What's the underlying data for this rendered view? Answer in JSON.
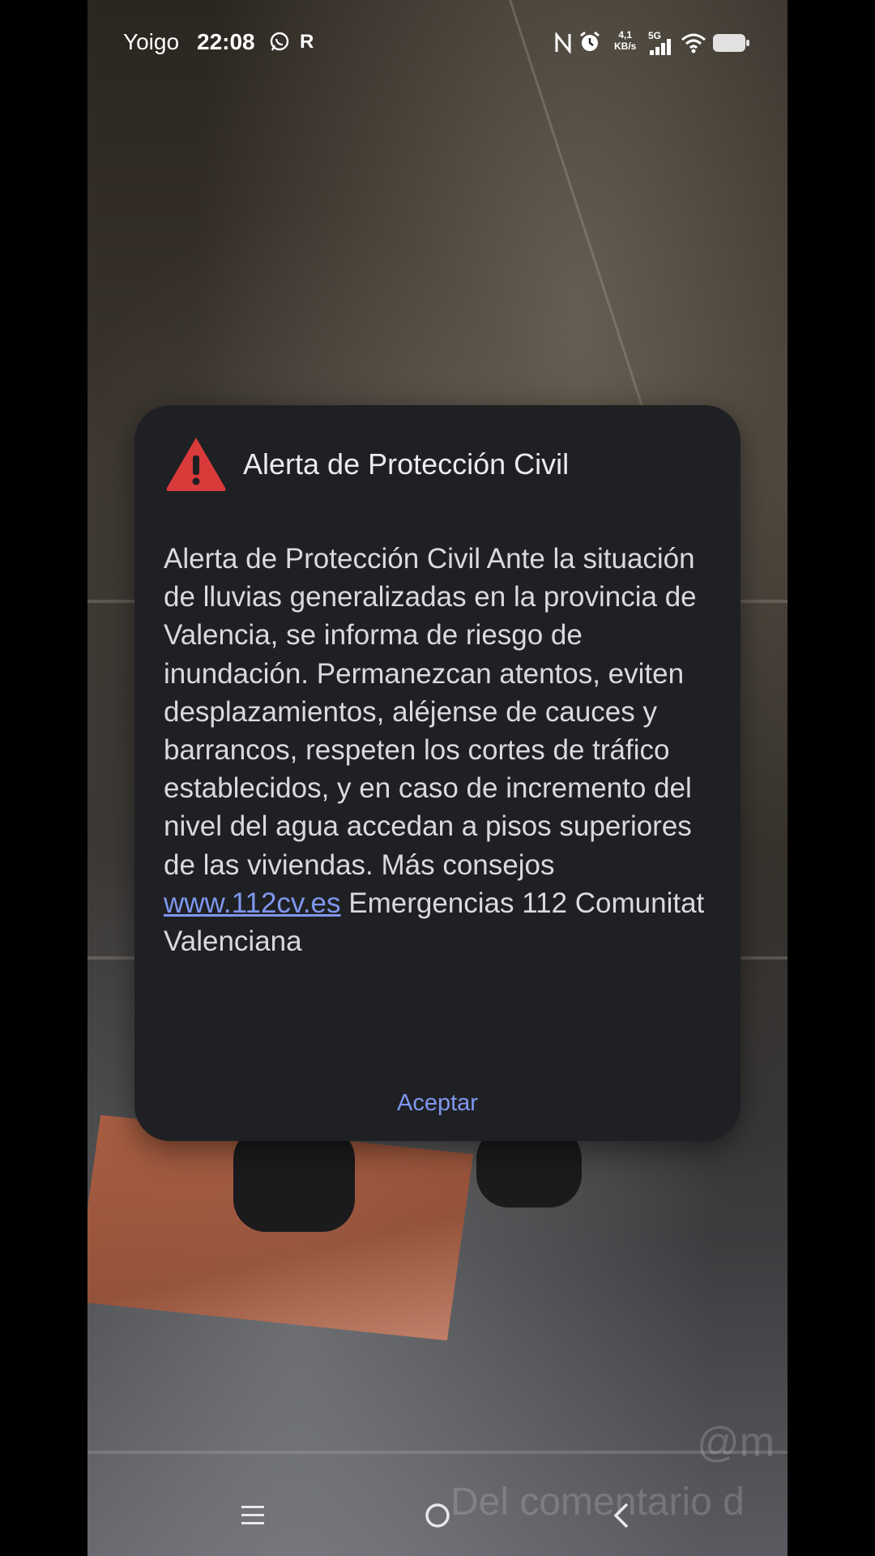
{
  "status_bar": {
    "carrier": "Yoigo",
    "time": "22:08",
    "roaming": "R",
    "speed_value": "4,1",
    "speed_unit": "KB/s",
    "network_type": "5G",
    "icons": [
      "whatsapp-icon",
      "nfc-icon",
      "alarm-icon",
      "signal-icon",
      "wifi-icon",
      "battery-icon"
    ]
  },
  "alert": {
    "title": "Alerta de Protección Civil",
    "body_text": "Alerta de Protección Civil Ante la situación de lluvias generalizadas en la provincia de Valencia, se informa de riesgo de inundación. Permanezcan atentos, eviten desplazamientos, aléjense de cauces y barrancos, respeten los cortes de tráfico establecidos, y en caso de incremento del nivel del agua accedan a pisos superiores de las viviendas. Más consejos",
    "link_text": "www.112cv.es",
    "body_tail": "Emergencias 112 Comunitat Valenciana",
    "accept_label": "Aceptar",
    "icon": "warning-icon",
    "colors": {
      "warning": "#d93a3a",
      "accent": "#7f97ee",
      "dialog_bg": "#1f2024"
    }
  },
  "nav_bar": {
    "icons": [
      "menu-icon",
      "home-icon",
      "back-icon"
    ]
  },
  "watermark": {
    "handle": "@m",
    "text": "Del comentario d"
  }
}
